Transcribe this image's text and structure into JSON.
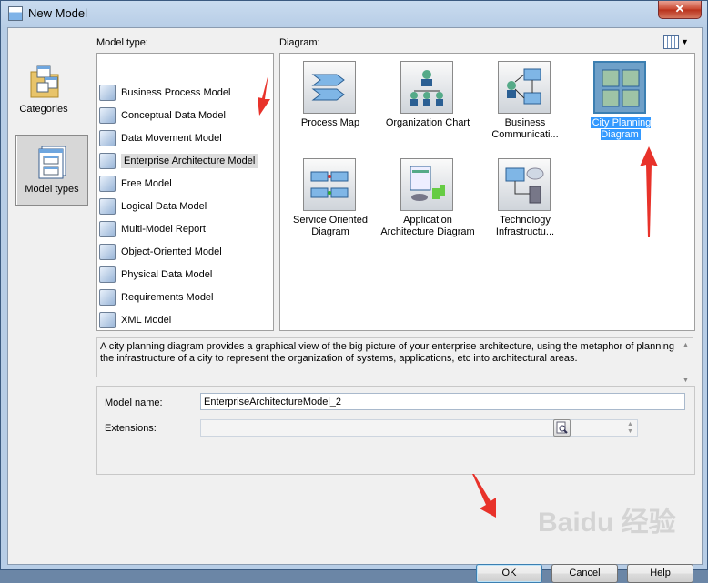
{
  "window": {
    "title": "New Model",
    "close_glyph": "✕"
  },
  "left_nav": [
    {
      "label": "Categories",
      "icon": "categories-icon",
      "selected": false
    },
    {
      "label": "Model types",
      "icon": "model-types-icon",
      "selected": true
    }
  ],
  "model_type_label": "Model type:",
  "model_types": [
    {
      "label": "Business Process Model",
      "icon": "business-process-icon"
    },
    {
      "label": "Conceptual Data Model",
      "icon": "conceptual-data-icon"
    },
    {
      "label": "Data Movement Model",
      "icon": "data-movement-icon"
    },
    {
      "label": "Enterprise Architecture Model",
      "icon": "enterprise-architecture-icon",
      "selected": true
    },
    {
      "label": "Free Model",
      "icon": "free-model-icon"
    },
    {
      "label": "Logical Data Model",
      "icon": "logical-data-icon"
    },
    {
      "label": "Multi-Model Report",
      "icon": "multi-model-report-icon"
    },
    {
      "label": "Object-Oriented Model",
      "icon": "object-oriented-icon"
    },
    {
      "label": "Physical Data Model",
      "icon": "physical-data-icon"
    },
    {
      "label": "Requirements Model",
      "icon": "requirements-icon"
    },
    {
      "label": "XML Model",
      "icon": "xml-model-icon"
    }
  ],
  "diagram_label": "Diagram:",
  "diagrams": [
    {
      "label": "Process Map",
      "icon": "process-map-icon"
    },
    {
      "label": "Organization Chart",
      "icon": "organization-chart-icon"
    },
    {
      "label": "Business Communicati...",
      "icon": "business-communication-icon"
    },
    {
      "label": "City Planning Diagram",
      "icon": "city-planning-icon",
      "selected": true
    },
    {
      "label": "Service Oriented Diagram",
      "icon": "service-oriented-icon"
    },
    {
      "label": "Application Architecture Diagram",
      "icon": "application-architecture-icon"
    },
    {
      "label": "Technology Infrastructu...",
      "icon": "technology-infrastructure-icon"
    }
  ],
  "description": "A city planning diagram provides a graphical view of the big picture of your enterprise architecture, using the metaphor of planning the infrastructure of a city to represent the organization of systems, applications, etc into architectural areas.",
  "form": {
    "model_name_label": "Model name:",
    "model_name_value": "EnterpriseArchitectureModel_2",
    "extensions_label": "Extensions:",
    "extensions_value": ""
  },
  "buttons": {
    "ok": "OK",
    "cancel": "Cancel",
    "help": "Help"
  },
  "watermark": "Baidu 经验"
}
